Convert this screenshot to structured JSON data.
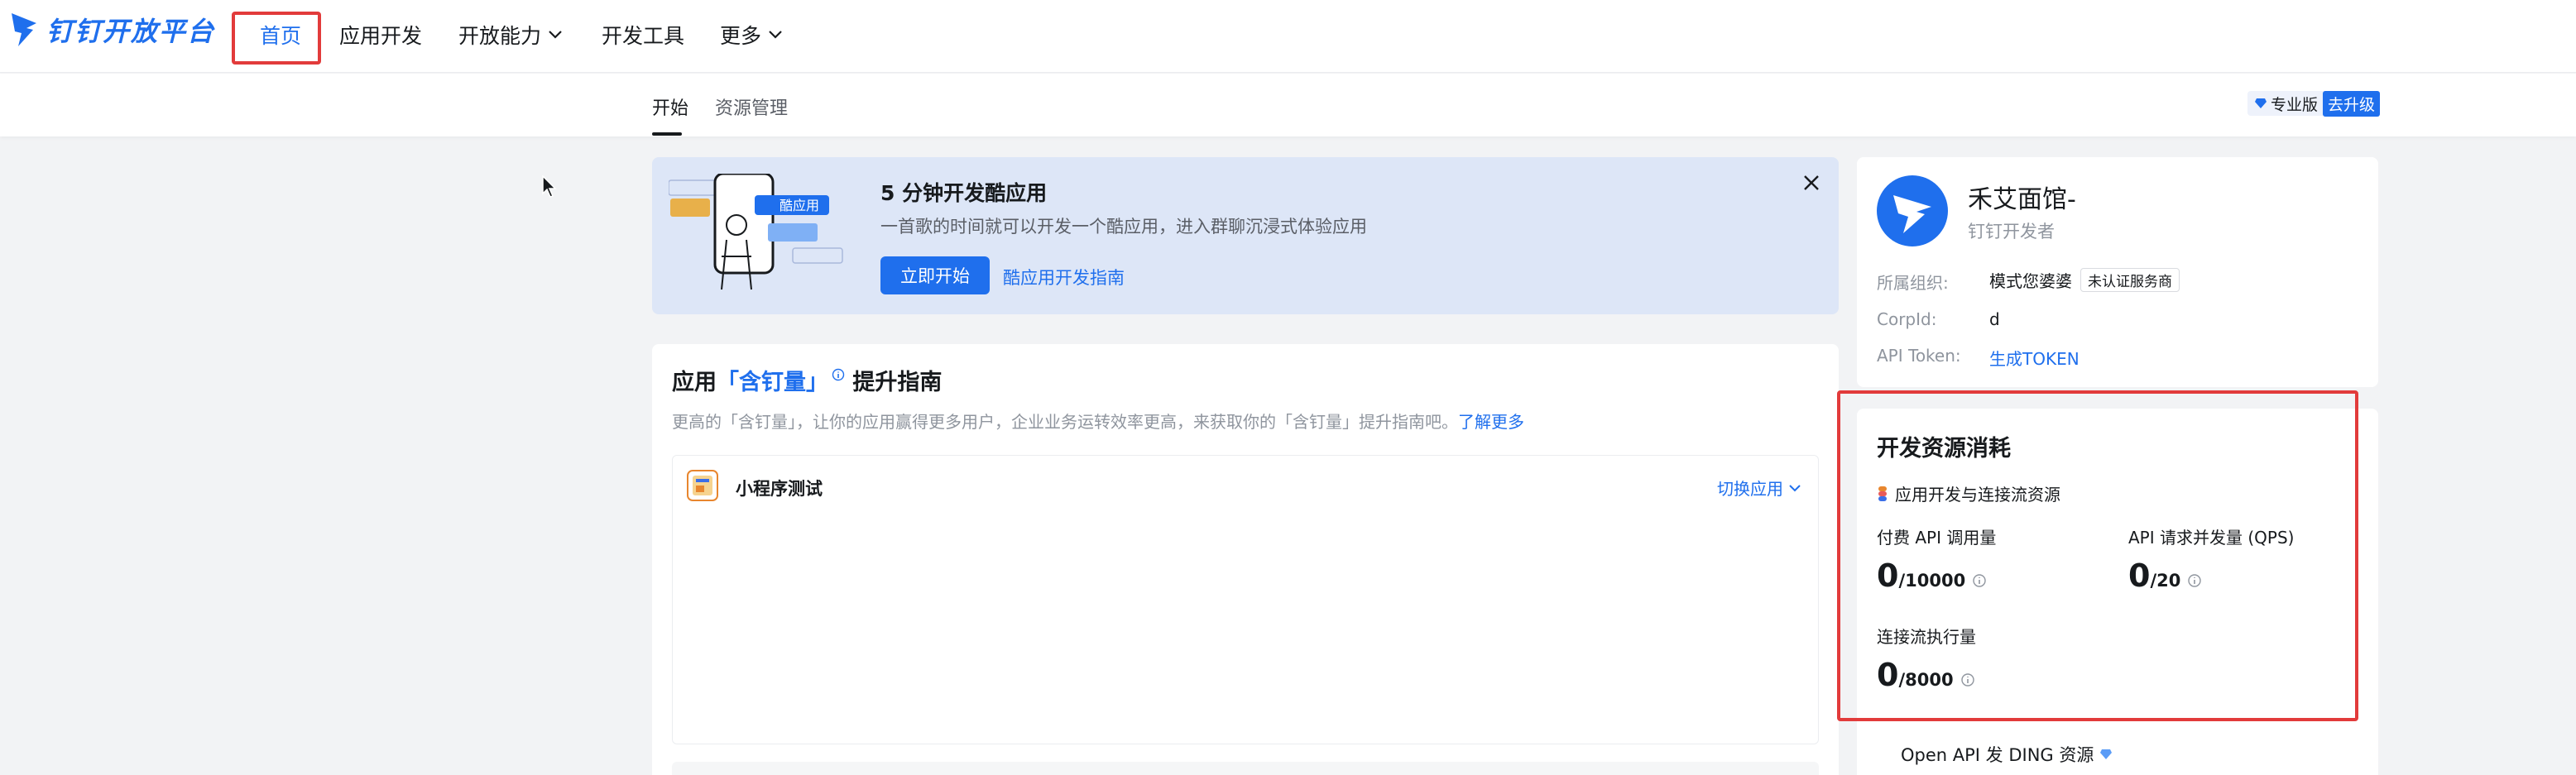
{
  "nav": {
    "logo_text": "钉钉开放平台",
    "items": [
      {
        "label": "首页"
      },
      {
        "label": "应用开发"
      },
      {
        "label": "开放能力"
      },
      {
        "label": "开发工具"
      },
      {
        "label": "更多"
      }
    ]
  },
  "subnav": {
    "tabs": [
      {
        "label": "开始"
      },
      {
        "label": "资源管理"
      }
    ],
    "badge_label": "专业版",
    "badge_action": "去升级"
  },
  "banner": {
    "title": "5 分钟开发酷应用",
    "desc": "一首歌的时间就可以开发一个酷应用，进入群聊沉浸式体验应用",
    "start_button": "立即开始",
    "guide_link": "酷应用开发指南",
    "illustration_tag": "酷应用"
  },
  "guide": {
    "title_pre": "应用",
    "title_highlight": "「含钉量」",
    "title_post": "提升指南",
    "desc": "更高的「含钉量」，让你的应用赢得更多用户，企业业务运转效率更高，来获取你的「含钉量」提升指南吧。",
    "desc_link": "了解更多",
    "app_name": "小程序测试",
    "switch_label": "切换应用"
  },
  "profile": {
    "name": "禾艾面馆-",
    "role": "钉钉开发者",
    "org_label": "所属组织:",
    "org_value": "模式您婆婆",
    "org_tag": "未认证服务商",
    "corpid_label": "CorpId:",
    "corpid_value": "d",
    "token_label": "API Token:",
    "token_value": "生成TOKEN"
  },
  "resource": {
    "title": "开发资源消耗",
    "subtitle": "应用开发与连接流资源",
    "metrics": [
      {
        "label": "付费 API 调用量",
        "used": "0",
        "total": "/10000"
      },
      {
        "label": "API 请求并发量 (QPS)",
        "used": "0",
        "total": "/20"
      },
      {
        "label": "连接流执行量",
        "used": "0",
        "total": "/8000"
      }
    ],
    "ding_label": "Open API 发 DING 资源"
  },
  "colors": {
    "accent": "#1f6fed",
    "highlight_border": "#e23b3b",
    "background": "#f2f3f5",
    "banner_bg": "#dde6f7"
  }
}
